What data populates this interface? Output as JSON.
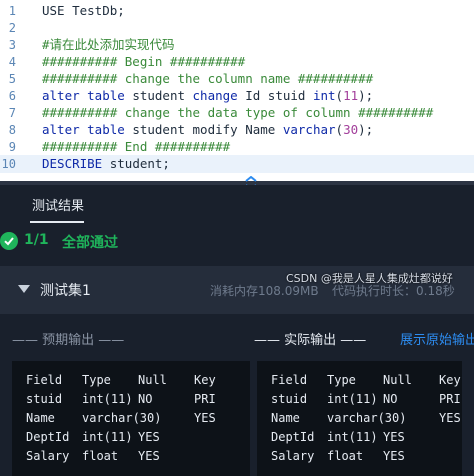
{
  "editor": {
    "lines": [
      {
        "n": "1",
        "parts": [
          {
            "t": "USE TestDb;",
            "c": "plain"
          }
        ]
      },
      {
        "n": "2",
        "parts": []
      },
      {
        "n": "3",
        "parts": [
          {
            "t": "#请在此处添加实现代码",
            "c": "cm"
          }
        ]
      },
      {
        "n": "4",
        "parts": [
          {
            "t": "########## Begin ##########",
            "c": "cm"
          }
        ]
      },
      {
        "n": "5",
        "parts": [
          {
            "t": "########## change the column name ##########",
            "c": "cm"
          }
        ]
      },
      {
        "n": "6",
        "parts": [
          {
            "t": "alter table",
            "c": "kw"
          },
          {
            "t": " student ",
            "c": "plain"
          },
          {
            "t": "change",
            "c": "kw"
          },
          {
            "t": " Id stuid ",
            "c": "plain"
          },
          {
            "t": "int",
            "c": "kw"
          },
          {
            "t": "(",
            "c": "plain"
          },
          {
            "t": "11",
            "c": "num"
          },
          {
            "t": ");",
            "c": "plain"
          }
        ]
      },
      {
        "n": "7",
        "parts": [
          {
            "t": "########## change the data type of column ##########",
            "c": "cm"
          }
        ]
      },
      {
        "n": "8",
        "parts": [
          {
            "t": "alter table",
            "c": "kw"
          },
          {
            "t": " student modify Name ",
            "c": "plain"
          },
          {
            "t": "varchar",
            "c": "kw"
          },
          {
            "t": "(",
            "c": "plain"
          },
          {
            "t": "30",
            "c": "num"
          },
          {
            "t": ");",
            "c": "plain"
          }
        ]
      },
      {
        "n": "9",
        "parts": [
          {
            "t": "########## End ##########",
            "c": "cm"
          }
        ]
      },
      {
        "n": "10",
        "parts": [
          {
            "t": "DESCRIBE",
            "c": "kw"
          },
          {
            "t": " student;",
            "c": "plain"
          }
        ]
      }
    ],
    "active_line": 9
  },
  "panel": {
    "tab_label": "测试结果",
    "summary": {
      "ratio": "1/1",
      "status": "全部通过"
    },
    "test_set": {
      "title": "测试集1",
      "memory": "消耗内存108.09MB",
      "time": "代码执行时长：0.18秒"
    },
    "expected_heading": "—— 预期输出 ——",
    "actual_heading": "—— 实际输出 ——",
    "raw_link": "展示原始输出",
    "expected_rows": [
      [
        "Field",
        "Type",
        "Null",
        "Key"
      ],
      [
        "stuid",
        "int(11)",
        "NO",
        "PRI"
      ],
      [
        "Name",
        "varchar(30)",
        "",
        "YES"
      ],
      [
        "DeptId",
        "int(11)",
        "YES",
        ""
      ],
      [
        "Salary",
        "float",
        "YES",
        ""
      ]
    ],
    "actual_rows": [
      [
        "Field",
        "Type",
        "Null",
        "Key"
      ],
      [
        "stuid",
        "int(11)",
        "NO",
        "PRI"
      ],
      [
        "Name",
        "varchar(30)",
        "",
        "YES"
      ],
      [
        "DeptId",
        "int(11)",
        "YES",
        ""
      ],
      [
        "Salary",
        "float",
        "YES",
        ""
      ]
    ]
  },
  "watermark": "CSDN @我是人星人集成灶都说好",
  "colors": {
    "pass": "#1fb45b",
    "link": "#2d8cf0",
    "keyword": "#0f2aa8",
    "comment": "#3a8a3a"
  }
}
